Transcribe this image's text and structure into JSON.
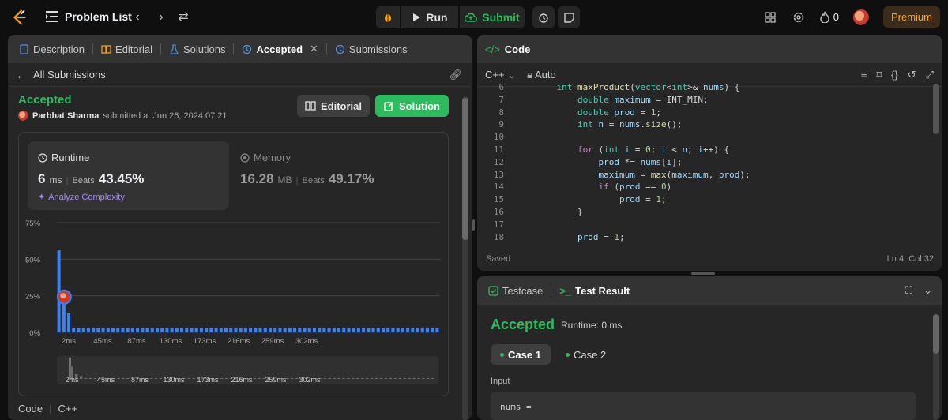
{
  "topbar": {
    "problem_list": "Problem List",
    "run": "Run",
    "submit": "Submit",
    "streak": "0",
    "premium": "Premium"
  },
  "left_tabs": [
    "Description",
    "Editorial",
    "Solutions",
    "Accepted",
    "Submissions"
  ],
  "all_submissions": "All Submissions",
  "result": {
    "status": "Accepted",
    "user": "Parbhat Sharma",
    "submitted": "submitted at Jun 26, 2024 07:21",
    "editorial_btn": "Editorial",
    "solution_btn": "Solution"
  },
  "runtime": {
    "label": "Runtime",
    "value": "6",
    "unit": "ms",
    "beats_label": "Beats",
    "beats": "43.45%",
    "analyze": "Analyze Complexity"
  },
  "memory": {
    "label": "Memory",
    "value": "16.28",
    "unit": "MB",
    "beats_label": "Beats",
    "beats": "49.17%"
  },
  "chart_data": {
    "type": "bar",
    "y_ticks": [
      "75%",
      "50%",
      "25%",
      "0%"
    ],
    "ylim": [
      0,
      75
    ],
    "x_ticks": [
      "2ms",
      "45ms",
      "87ms",
      "130ms",
      "173ms",
      "216ms",
      "259ms",
      "302ms"
    ],
    "values": [
      56,
      22,
      13,
      3,
      3,
      3,
      3,
      3,
      3,
      3,
      3,
      3,
      3,
      3,
      3,
      3,
      3,
      3,
      3,
      3,
      3,
      3,
      3,
      3,
      3,
      3,
      3,
      3,
      3,
      3,
      3,
      3,
      3,
      3,
      3,
      3,
      3,
      3,
      3,
      3,
      3,
      3,
      3,
      3,
      3,
      3,
      3,
      3,
      3,
      3,
      3,
      3,
      3,
      3,
      3,
      3,
      3,
      3,
      3,
      3,
      3,
      3,
      3,
      3,
      3,
      3,
      3,
      3,
      3,
      3,
      3,
      3,
      3,
      3,
      3,
      3,
      3,
      3
    ],
    "highlight_index": 1,
    "bar_color": "#3b82f6",
    "mini_x_ticks": [
      "2ms",
      "45ms",
      "87ms",
      "130ms",
      "173ms",
      "216ms",
      "259ms",
      "302ms"
    ]
  },
  "left_footer": {
    "code": "Code",
    "lang": "C++"
  },
  "code_panel": {
    "title": "Code",
    "language": "C++",
    "mode": "Auto",
    "status": "Saved",
    "cursor": "Ln 4, Col 32",
    "line_numbers": [
      "6",
      "7",
      "8",
      "9",
      "10",
      "11",
      "12",
      "13",
      "14",
      "15",
      "16",
      "17",
      "18"
    ]
  },
  "test_panel": {
    "tab1": "Testcase",
    "tab2": "Test Result",
    "status": "Accepted",
    "runtime": "Runtime: 0 ms",
    "case1": "Case 1",
    "case2": "Case 2",
    "input_label": "Input",
    "input_value": "nums ="
  },
  "colors": {
    "accent_green": "#2cbb5d",
    "premium": "#ffa116",
    "bar": "#3b82f6"
  }
}
